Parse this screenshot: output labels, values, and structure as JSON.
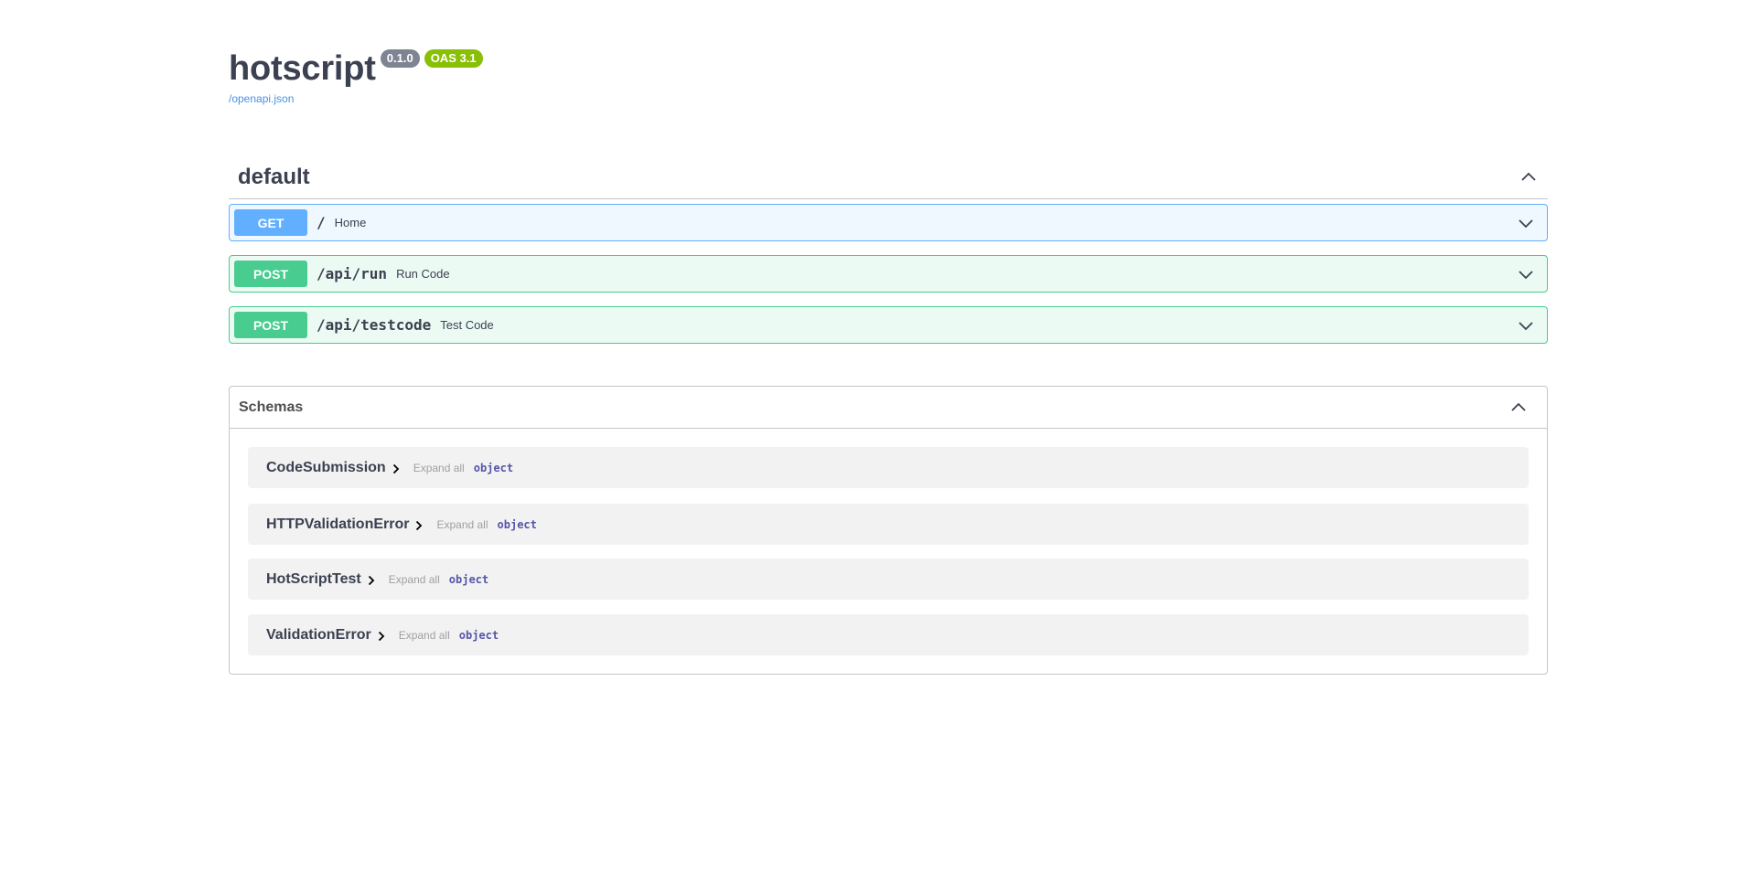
{
  "info": {
    "title": "hotscript",
    "version_badge": "0.1.0",
    "oas_badge": "OAS 3.1",
    "spec_link": "/openapi.json"
  },
  "tag": {
    "name": "default",
    "operations": [
      {
        "method": "GET",
        "path": "/",
        "summary": "Home"
      },
      {
        "method": "POST",
        "path": "/api/run",
        "summary": "Run Code"
      },
      {
        "method": "POST",
        "path": "/api/testcode",
        "summary": "Test Code"
      }
    ]
  },
  "schemas": {
    "title": "Schemas",
    "items": [
      {
        "name": "CodeSubmission",
        "expand": "Expand all",
        "type": "object"
      },
      {
        "name": "HTTPValidationError",
        "expand": "Expand all",
        "type": "object"
      },
      {
        "name": "HotScriptTest",
        "expand": "Expand all",
        "type": "object"
      },
      {
        "name": "ValidationError",
        "expand": "Expand all",
        "type": "object"
      }
    ]
  },
  "icons": {
    "collapse": "chevron-up-icon",
    "expand": "chevron-down-icon",
    "model_arrow": "chevron-right-icon"
  },
  "colors": {
    "get": "#61affe",
    "post": "#49cc90",
    "version_badge": "#7d8492",
    "oas_badge": "#89bf04",
    "link": "#4990e2",
    "type": "#55aa"
  }
}
